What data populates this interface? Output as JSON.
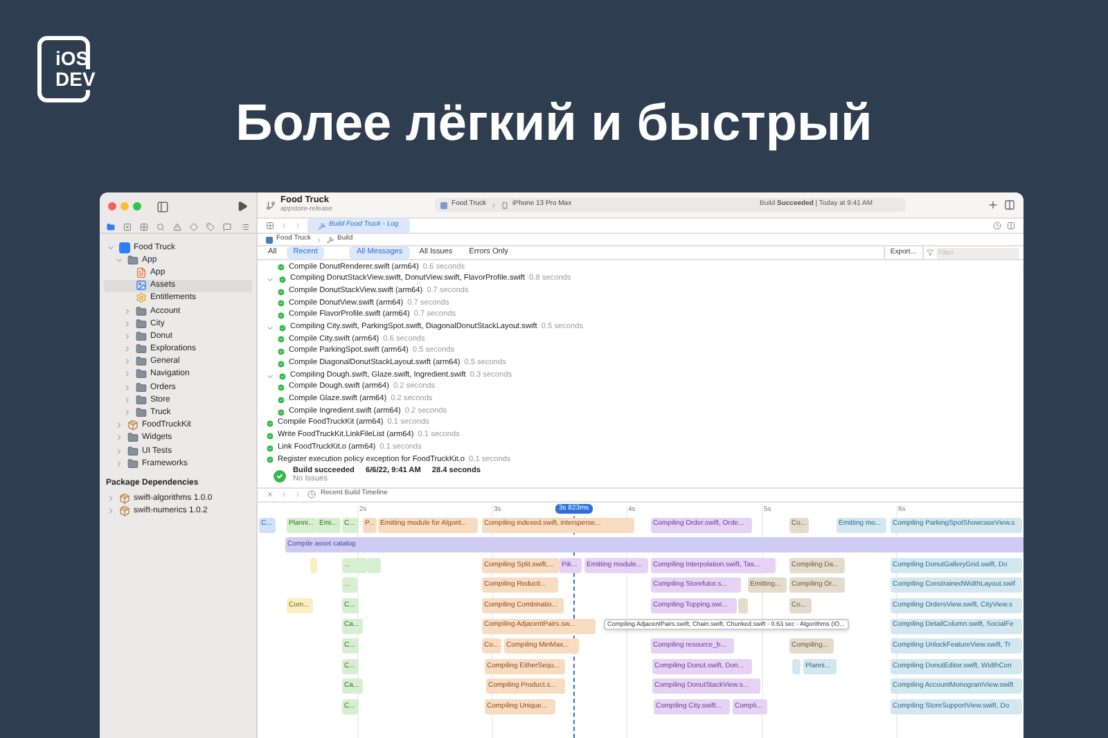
{
  "logo": {
    "line_1": "iOS",
    "line_2": "DEV"
  },
  "headline": "Более лёгкий и быстрый",
  "window": {
    "project": "Food Truck",
    "branch": "appstore-release",
    "scheme": "Food Truck",
    "device": "iPhone 13 Pro Max",
    "status": "Build **Succeeded** | Today at 9:41 AM"
  },
  "sidebar": {
    "items": [
      {
        "label": "Food Truck",
        "kind": "project",
        "expanded": true,
        "selected": false,
        "children": [
          {
            "label": "App",
            "kind": "folder",
            "expanded": true,
            "selected": false,
            "children": [
              {
                "label": "App",
                "kind": "swift",
                "selected": false
              },
              {
                "label": "Assets",
                "kind": "assets",
                "selected": true
              },
              {
                "label": "Entitlements",
                "kind": "entitlements",
                "selected": false
              },
              {
                "label": "Account",
                "kind": "folder",
                "expanded": false,
                "selected": false
              },
              {
                "label": "City",
                "kind": "folder",
                "expanded": false,
                "selected": false
              },
              {
                "label": "Donut",
                "kind": "folder",
                "expanded": false,
                "selected": false
              },
              {
                "label": "Explorations",
                "kind": "folder",
                "expanded": false,
                "selected": false
              },
              {
                "label": "General",
                "kind": "folder",
                "expanded": false,
                "selected": false
              },
              {
                "label": "Navigation",
                "kind": "folder",
                "expanded": false,
                "selected": false
              },
              {
                "label": "Orders",
                "kind": "folder",
                "expanded": false,
                "selected": false
              },
              {
                "label": "Store",
                "kind": "folder",
                "expanded": false,
                "selected": false
              },
              {
                "label": "Truck",
                "kind": "folder",
                "expanded": false,
                "selected": false
              }
            ]
          },
          {
            "label": "FoodTruckKit",
            "kind": "package",
            "expanded": false,
            "selected": false
          },
          {
            "label": "Widgets",
            "kind": "folder",
            "expanded": false,
            "selected": false
          },
          {
            "label": "UI Tests",
            "kind": "folder",
            "expanded": false,
            "selected": false
          },
          {
            "label": "Frameworks",
            "kind": "folder",
            "expanded": false,
            "selected": false
          }
        ]
      }
    ],
    "section_title": "Package Dependencies",
    "packages": [
      {
        "label": "swift-algorithms 1.0.0",
        "kind": "package",
        "expanded": false,
        "selected": false
      },
      {
        "label": "swift-numerics 1.0.2",
        "kind": "package",
        "expanded": false,
        "selected": false
      }
    ]
  },
  "editor_tab": "Build Food Truck - Log",
  "breadcrumb": [
    "Food Truck",
    "Build"
  ],
  "filters": {
    "scope": [
      {
        "label": "All",
        "selected": false
      },
      {
        "label": "Recent",
        "selected": true
      }
    ],
    "messages": [
      {
        "label": "All Messages",
        "selected": true
      },
      {
        "label": "All Issues",
        "selected": false
      },
      {
        "label": "Errors Only",
        "selected": false
      }
    ],
    "export": "Export...",
    "search": {
      "placeholder": "Filter"
    }
  },
  "log": [
    {
      "text": "Compile DonutRenderer.swift (arm64)",
      "time": "0.6 seconds"
    },
    {
      "text": "Compiling DonutStackView.swift, DonutView.swift, FlavorProfile.swift",
      "time": "0.8 seconds",
      "expanded": true,
      "children": [
        {
          "text": "Compile DonutStackView.swift (arm64)",
          "time": "0.7 seconds"
        },
        {
          "text": "Compile DonutView.swift (arm64)",
          "time": "0.7 seconds"
        },
        {
          "text": "Compile FlavorProfile.swift (arm64)",
          "time": "0.7 seconds"
        }
      ]
    },
    {
      "text": "Compiling City.swift, ParkingSpot.swift, DiagonalDonutStackLayout.swift",
      "time": "0.5 seconds",
      "expanded": true,
      "children": [
        {
          "text": "Compile City.swift (arm64)",
          "time": "0.6 seconds"
        },
        {
          "text": "Compile ParkingSpot.swift (arm64)",
          "time": "0.5 seconds"
        },
        {
          "text": "Compile DiagonalDonutStackLayout.swift (arm64)",
          "time": "0.5 seconds"
        }
      ]
    },
    {
      "text": "Compiling Dough.swift, Glaze.swift, Ingredient.swift",
      "time": "0.3 seconds",
      "expanded": true,
      "children": [
        {
          "text": "Compile Dough.swift (arm64)",
          "time": "0.2 seconds"
        },
        {
          "text": "Compile Glaze.swift (arm64)",
          "time": "0.2 seconds"
        },
        {
          "text": "Compile Ingredient.swift (arm64)",
          "time": "0.2 seconds"
        }
      ]
    },
    {
      "text": "Compile FoodTruckKit (arm64)",
      "time": "0.1 seconds"
    },
    {
      "text": "Write FoodTruckKit.LinkFileList (arm64)",
      "time": "0.1 seconds"
    },
    {
      "text": "Link FoodTruckKit.o (arm64)",
      "time": "0.1 seconds"
    },
    {
      "text": "Register execution policy exception for FoodTruckKit.o",
      "time": "0.1 seconds"
    }
  ],
  "summary": {
    "title": "Build succeeded",
    "date": "6/6/22, 9:41 AM",
    "duration": "28.4 seconds",
    "issues": "No Issues"
  },
  "timeline": {
    "title": "Recent Build Timeline",
    "ticks": [
      "2s",
      "3s",
      "4s",
      "5s",
      "6s"
    ],
    "playhead": "3s 823ms",
    "lanes": [
      {
        "bars": [
          {
            "kind": "asset",
            "text": "C..."
          },
          {
            "kind": "green",
            "text": "Planni..."
          },
          {
            "kind": "green",
            "text": "Emi..."
          },
          {
            "kind": "green",
            "text": "C..."
          },
          {
            "kind": "orange",
            "text": "P..."
          },
          {
            "kind": "orange",
            "text": "Emitting module for Algorit..."
          },
          {
            "kind": "orange",
            "text": "Compiling indexed.swift, intersperse..."
          },
          {
            "kind": "purple",
            "text": "Compiling Order.swift, Orde..."
          },
          {
            "kind": "tan",
            "text": "Co..."
          },
          {
            "kind": "blue",
            "text": "Emitting mo..."
          },
          {
            "kind": "blue",
            "text": "Compiling ParkingSpotShowcaseView.s"
          }
        ]
      },
      {
        "bars": [
          {
            "kind": "lavender",
            "text": "Compile asset catalog"
          }
        ]
      },
      {
        "bars": [
          {
            "kind": "yellow"
          },
          {
            "kind": "green",
            "text": "..."
          },
          {
            "kind": "green"
          },
          {
            "kind": "orange",
            "text": "Compiling Split.swift,..."
          },
          {
            "kind": "purple",
            "text": "Pik..."
          },
          {
            "kind": "purple",
            "text": "Emitting module..."
          },
          {
            "kind": "purple",
            "text": "Compiling Interpolation.swift, Tas..."
          },
          {
            "kind": "tan",
            "text": "Compiling Da..."
          },
          {
            "kind": "blue",
            "text": "Compiling DonutGalleryGrid.swift, Do"
          }
        ]
      },
      {
        "bars": [
          {
            "kind": "green",
            "text": "..."
          },
          {
            "kind": "orange",
            "text": "Compiling Reducti..."
          },
          {
            "kind": "purple",
            "text": "Compiling Storefutor.s..."
          },
          {
            "kind": "tan",
            "text": "Emitting..."
          },
          {
            "kind": "tan",
            "text": "Compiling Or..."
          },
          {
            "kind": "blue",
            "text": "Compiling ConstrainedWidthLayout.swif"
          }
        ]
      },
      {
        "bars": [
          {
            "kind": "yellow",
            "text": "Com..."
          },
          {
            "kind": "green",
            "text": "C..."
          },
          {
            "kind": "orange",
            "text": "Compiling Combinatio..."
          },
          {
            "kind": "purple",
            "text": "Compiling Topping.swi..."
          },
          {
            "kind": "tan"
          },
          {
            "kind": "tan",
            "text": "Co..."
          },
          {
            "kind": "blue",
            "text": "Compiling OrdersView.swift, CityView.s"
          }
        ]
      },
      {
        "bars": [
          {
            "kind": "green",
            "text": "Ca..."
          },
          {
            "kind": "orange",
            "text": "Compiling AdjacentPairs.sw..."
          },
          {
            "kind": "blue",
            "text": "Compiling DetailColumn.swift, SocialFe"
          }
        ]
      },
      {
        "bars": [
          {
            "kind": "green",
            "text": "C..."
          },
          {
            "kind": "orange",
            "text": "Co..."
          },
          {
            "kind": "orange",
            "text": "Compiling MinMax..."
          },
          {
            "kind": "purple",
            "text": "Compiling resource_b..."
          },
          {
            "kind": "tan",
            "text": "Compiling..."
          },
          {
            "kind": "blue",
            "text": "Compiling UnlockFeatureView.swift, Tr"
          }
        ]
      },
      {
        "bars": [
          {
            "kind": "green",
            "text": "C..."
          },
          {
            "kind": "orange",
            "text": "Compiling EitherSequ..."
          },
          {
            "kind": "purple",
            "text": "Compiling Donut.swift, Don..."
          },
          {
            "kind": "blue"
          },
          {
            "kind": "blue",
            "text": "Planni..."
          },
          {
            "kind": "blue",
            "text": "Compiling DonutEditor.swift, WidthCon"
          }
        ]
      },
      {
        "bars": [
          {
            "kind": "green",
            "text": "Ca..."
          },
          {
            "kind": "orange",
            "text": "Compiling Product.s..."
          },
          {
            "kind": "purple",
            "text": "Compiling DonutStackView.s..."
          },
          {
            "kind": "blue",
            "text": "Compiling AccountMonogramView.swift"
          }
        ]
      },
      {
        "bars": [
          {
            "kind": "green",
            "text": "C..."
          },
          {
            "kind": "orange",
            "text": "Compiling Unique..."
          },
          {
            "kind": "purple",
            "text": "Compiling City.swift..."
          },
          {
            "kind": "purple",
            "text": "Compli..."
          },
          {
            "kind": "blue",
            "text": "Compiling StoreSupportView.swift, Do"
          }
        ]
      }
    ],
    "tooltip": "Compiling AdjacentPairs.swift, Chain.swift, Chunked.swift - 0.63 sec - Algorithms (iO..."
  }
}
